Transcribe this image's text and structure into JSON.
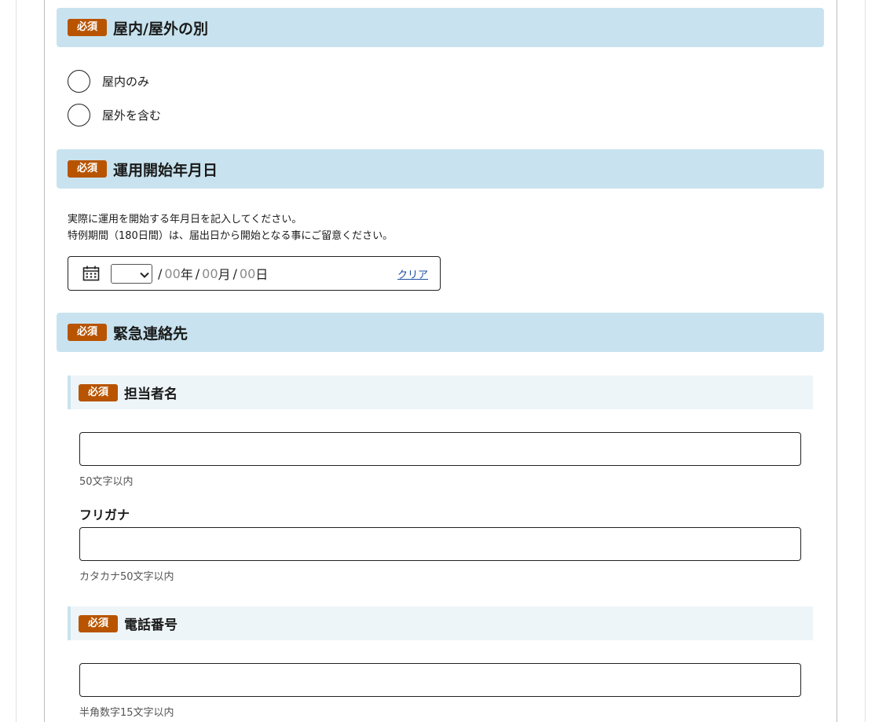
{
  "required_badge": "必須",
  "indoor_outdoor": {
    "title": "屋内/屋外の別",
    "options": [
      "屋内のみ",
      "屋外を含む"
    ]
  },
  "start_date": {
    "title": "運用開始年月日",
    "description_1": "実際に運用を開始する年月日を記入してください。",
    "description_2": "特例期間（180日間）は、届出日から開始となる事にご留意ください。",
    "year_placeholder": "00",
    "year_unit": "年",
    "month_placeholder": "00",
    "month_unit": "月",
    "day_placeholder": "00",
    "day_unit": "日",
    "clear_label": "クリア"
  },
  "emergency_contact": {
    "title": "緊急連絡先",
    "person_name": {
      "title": "担当者名",
      "hint": "50文字以内",
      "furigana_label": "フリガナ",
      "furigana_hint": "カタカナ50文字以内"
    },
    "phone": {
      "title": "電話番号",
      "hint": "半角数字15文字以内"
    }
  },
  "colors": {
    "section_bg": "#c8e3ef",
    "sub_section_bg": "#eef5f9",
    "required_badge": "#b85400",
    "link": "#1a4fa0"
  }
}
